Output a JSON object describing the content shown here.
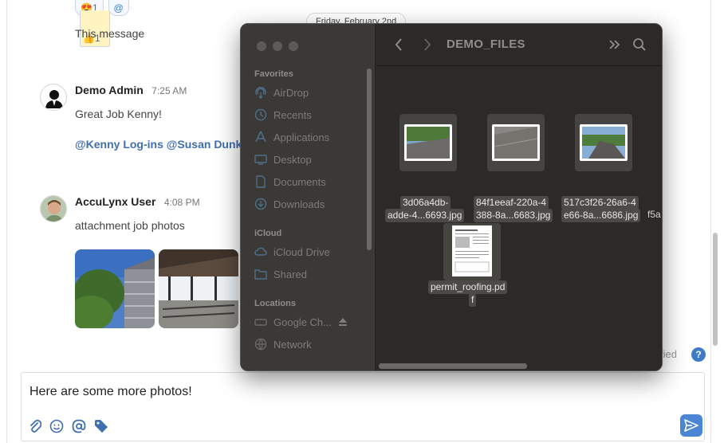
{
  "chat": {
    "reactions": [
      {
        "icon": "thumbs-up-icon",
        "glyph": "👍",
        "count": "1"
      },
      {
        "icon": "heart-eyes-icon",
        "glyph": "😍",
        "count": "1"
      },
      {
        "icon": "add-reaction-icon",
        "glyph": "@",
        "count": ""
      }
    ],
    "date_divider": "Friday, February 2nd",
    "previous_text": "This message",
    "messages": [
      {
        "author": "Demo Admin",
        "time": "7:25 AM",
        "body": "Great Job Kenny!",
        "mentions": "@Kenny Log-ins @Susan Dunkle"
      },
      {
        "author": "AccuLynx User",
        "time": "4:08 PM",
        "body": "attachment job photos"
      }
    ],
    "verified_text": "fied",
    "help_glyph": "?",
    "composer_text": "Here are some more photos!",
    "composer_tools": [
      "paperclip-icon",
      "emoji-icon",
      "at-mention-icon",
      "tag-icon"
    ],
    "send_icon": "send-icon"
  },
  "finder": {
    "folder_title": "DEMO_FILES",
    "sidebar": {
      "favorites_label": "Favorites",
      "favorites": [
        {
          "label": "AirDrop",
          "icon": "airdrop-icon"
        },
        {
          "label": "Recents",
          "icon": "clock-icon"
        },
        {
          "label": "Applications",
          "icon": "applications-icon"
        },
        {
          "label": "Desktop",
          "icon": "desktop-icon"
        },
        {
          "label": "Documents",
          "icon": "document-icon"
        },
        {
          "label": "Downloads",
          "icon": "download-icon"
        }
      ],
      "icloud_label": "iCloud",
      "icloud": [
        {
          "label": "iCloud Drive",
          "icon": "cloud-icon"
        },
        {
          "label": "Shared",
          "icon": "shared-folder-icon"
        }
      ],
      "locations_label": "Locations",
      "locations": [
        {
          "label": "Google Ch...",
          "icon": "drive-icon"
        },
        {
          "label": "Network",
          "icon": "globe-icon"
        }
      ]
    },
    "files": [
      {
        "line1": "3d06a4db-",
        "line2": "adde-4...6693.jpg"
      },
      {
        "line1": "84f1eeaf-220a-4",
        "line2": "388-8a...6683.jpg"
      },
      {
        "line1": "517c3f26-26a6-4",
        "line2": "e66-8a...6686.jpg"
      },
      {
        "line1": "permit_roofing.pd",
        "line2": "f"
      }
    ],
    "clipped_name": "f5a"
  }
}
